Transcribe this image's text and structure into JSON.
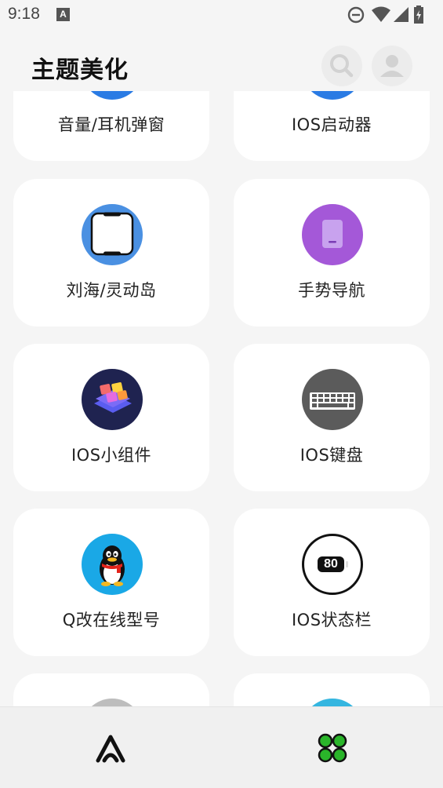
{
  "status_bar": {
    "time": "9:18",
    "notification_icon": "a-letter-icon",
    "icons": [
      "dnd-icon",
      "wifi-icon",
      "signal-icon",
      "battery-icon"
    ]
  },
  "header": {
    "title": "主题美化",
    "search_icon": "search-icon",
    "avatar_icon": "avatar-icon"
  },
  "grid": {
    "items": [
      {
        "label": "音量/耳机弹窗",
        "icon": "volume-popup-icon",
        "icon_color": "#2a7be4"
      },
      {
        "label": "IOS启动器",
        "icon": "ios-launcher-icon",
        "icon_color": "#2a7be4"
      },
      {
        "label": "刘海/灵动岛",
        "icon": "notch-icon",
        "icon_color": "#4a90e2"
      },
      {
        "label": "手势导航",
        "icon": "gesture-nav-icon",
        "icon_color": "#a458d8"
      },
      {
        "label": "IOS小组件",
        "icon": "widgets-icon",
        "icon_color": "#1f2350"
      },
      {
        "label": "IOS键盘",
        "icon": "keyboard-icon",
        "icon_color": "#5b5b5b"
      },
      {
        "label": "Q改在线型号",
        "icon": "qq-penguin-icon",
        "icon_color": "#1aa8e6"
      },
      {
        "label": "IOS状态栏",
        "icon": "status-bar-icon",
        "battery_text": "80",
        "icon_color": "#ffffff"
      },
      {
        "label": "",
        "icon": "gray-circle-icon",
        "icon_color": "#bdbdbd"
      },
      {
        "label": "",
        "icon": "compass-icon",
        "icon_color": "#35b6e0"
      }
    ]
  },
  "bottom_nav": {
    "items": [
      {
        "icon": "theme-a-icon"
      },
      {
        "icon": "apps-grid-icon",
        "color": "#2ab52a"
      }
    ]
  }
}
